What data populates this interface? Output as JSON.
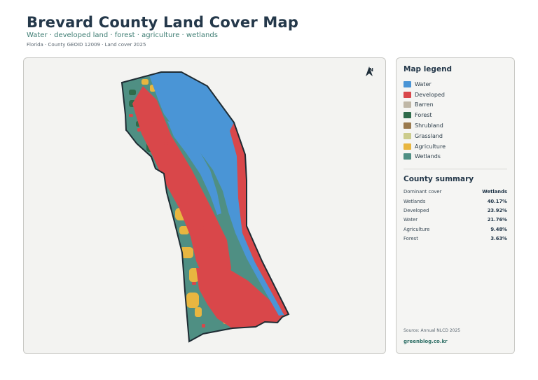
{
  "header": {
    "title": "Brevard County Land Cover Map",
    "subtitle": "Water · developed land · forest · agriculture · wetlands",
    "meta": "Florida · County GEOID 12009 · Land cover 2025"
  },
  "map": {
    "north_label": "N",
    "north_icon": "north-arrow-icon",
    "colors": {
      "water": "#4a95d6",
      "developed": "#d9474a",
      "forest": "#2f6b4a",
      "agriculture": "#e8b640",
      "wetlands": "#4f8f83",
      "outline": "#1e2b33"
    }
  },
  "legend": {
    "title": "Map legend",
    "items": [
      {
        "label": "Water",
        "color": "#4a95d6"
      },
      {
        "label": "Developed",
        "color": "#d9474a"
      },
      {
        "label": "Barren",
        "color": "#bfb7a6"
      },
      {
        "label": "Forest",
        "color": "#2f6b4a"
      },
      {
        "label": "Shrubland",
        "color": "#9a7a4e"
      },
      {
        "label": "Grassland",
        "color": "#cccc8c"
      },
      {
        "label": "Agriculture",
        "color": "#e8b640"
      },
      {
        "label": "Wetlands",
        "color": "#4f8f83"
      }
    ]
  },
  "summary": {
    "title": "County summary",
    "rows": [
      {
        "label": "Dominant cover",
        "value": "Wetlands"
      },
      {
        "label": "Wetlands",
        "value": "40.17%"
      },
      {
        "label": "Developed",
        "value": "23.92%"
      },
      {
        "label": "Water",
        "value": "21.76%"
      },
      {
        "label": "Agriculture",
        "value": "9.48%"
      },
      {
        "label": "Forest",
        "value": "3.63%"
      }
    ]
  },
  "footer": {
    "source": "Source: Annual NLCD 2025",
    "brand": "greenblog.co.kr"
  }
}
